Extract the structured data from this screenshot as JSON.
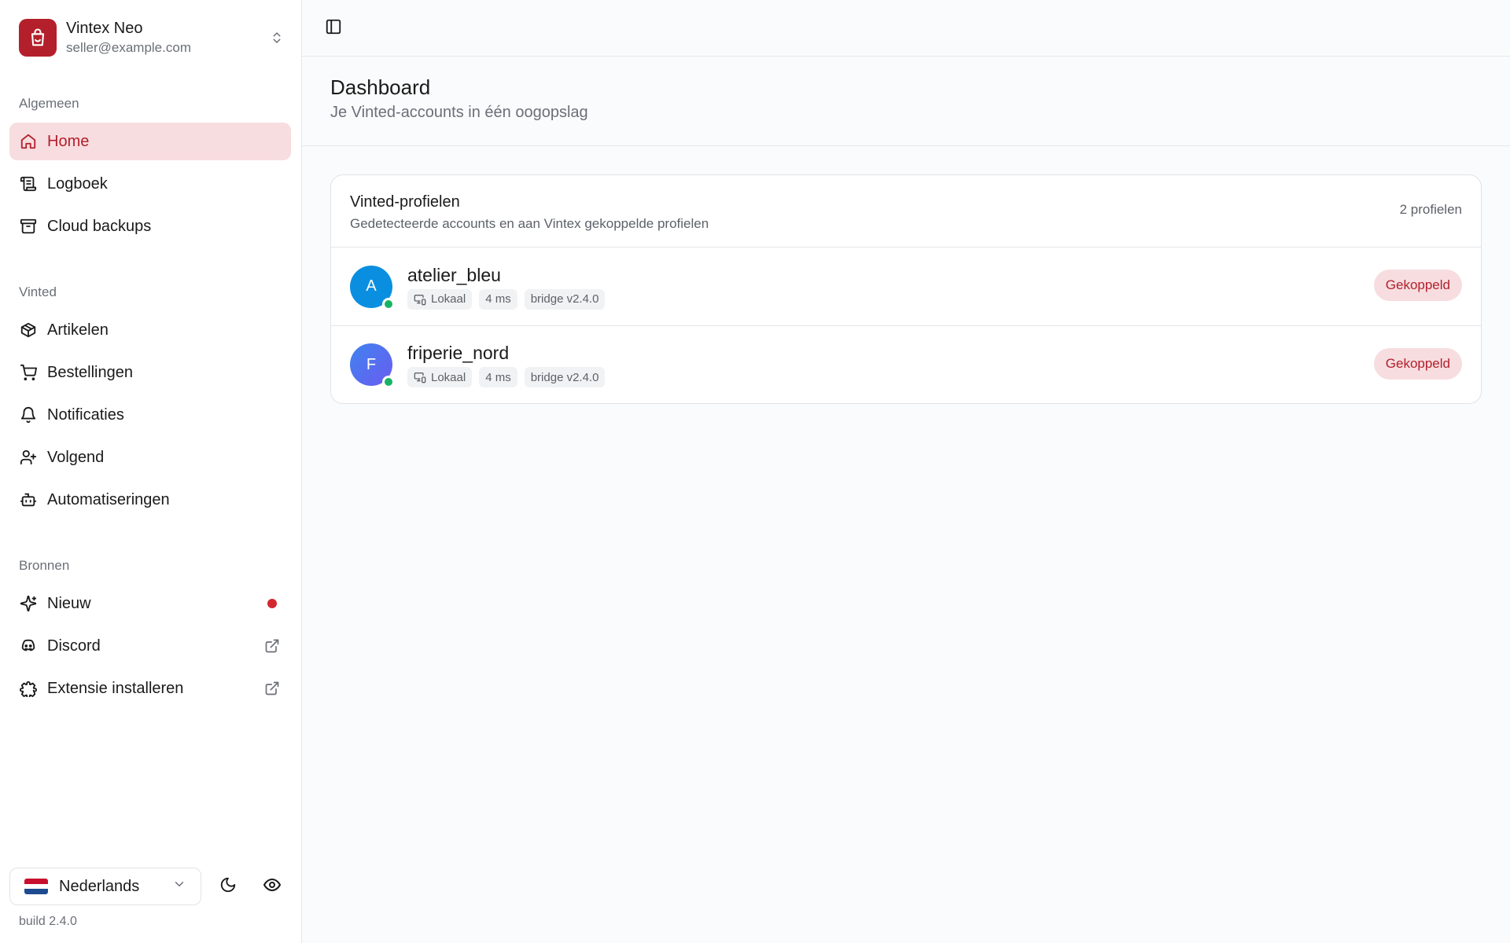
{
  "account": {
    "name": "Vintex Neo",
    "email": "seller@example.com"
  },
  "sections": {
    "general": "Algemeen",
    "vinted": "Vinted",
    "sources": "Bronnen"
  },
  "nav": {
    "home": "Home",
    "log": "Logboek",
    "backups": "Cloud backups",
    "items": "Artikelen",
    "orders": "Bestellingen",
    "notifications": "Notificaties",
    "following": "Volgend",
    "automations": "Automatiseringen",
    "new": "Nieuw",
    "discord": "Discord",
    "extension": "Extensie installeren"
  },
  "footer": {
    "language": "Nederlands",
    "build": "build 2.4.0"
  },
  "page": {
    "title": "Dashboard",
    "subtitle": "Je Vinted-accounts in één oogopslag"
  },
  "profiles_card": {
    "title": "Vinted-profielen",
    "description": "Gedetecteerde accounts en aan Vintex gekoppelde profielen",
    "count": "2 profielen",
    "rows": [
      {
        "initial": "A",
        "name": "atelier_bleu",
        "source": "Lokaal",
        "latency": "4 ms",
        "bridge": "bridge v2.4.0",
        "status": "Gekoppeld"
      },
      {
        "initial": "F",
        "name": "friperie_nord",
        "source": "Lokaal",
        "latency": "4 ms",
        "bridge": "bridge v2.4.0",
        "status": "Gekoppeld"
      }
    ]
  },
  "colors": {
    "accent": "#b3202b",
    "accent_soft": "#f7dde0",
    "online": "#16b364",
    "avatar_a": "#0a8fe0",
    "avatar_f": "#5b6cf0"
  }
}
